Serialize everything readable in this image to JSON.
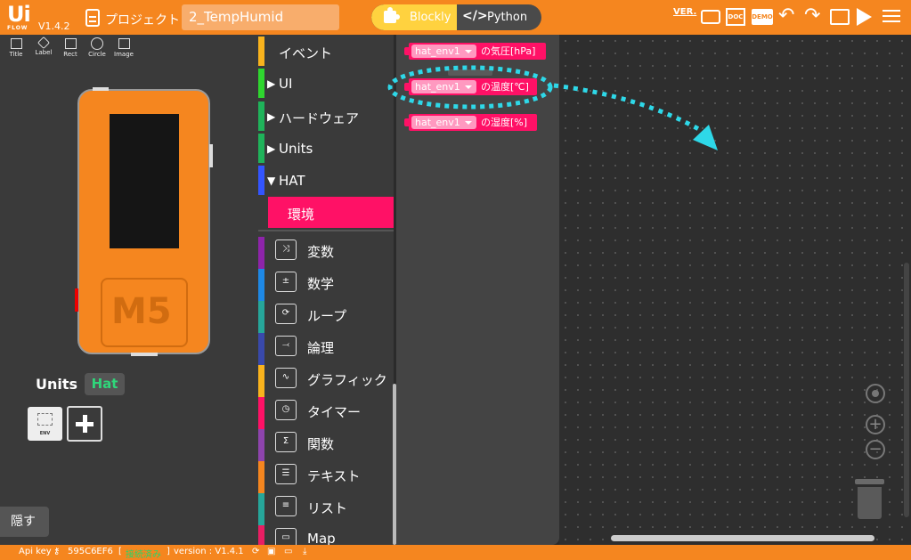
{
  "app": {
    "logo_text": "Ui",
    "logo_sub": "FLOW",
    "version": "V1.4.2",
    "project_label": "プロジェクト",
    "project_name": "2_TempHumid",
    "mode_blockly": "Blockly",
    "mode_python": "Python",
    "tool_ver": "VER.",
    "tool_doc": "DOC",
    "tool_demo": "DEMO",
    "accent_color": "#f5861f"
  },
  "shapes": [
    {
      "label": "Title",
      "icon": "title-icon"
    },
    {
      "label": "Label",
      "icon": "label-icon"
    },
    {
      "label": "Rect",
      "icon": "rect-icon"
    },
    {
      "label": "Circle",
      "icon": "circle-icon"
    },
    {
      "label": "Image",
      "icon": "image-icon"
    }
  ],
  "device": {
    "logo": "M5"
  },
  "units": {
    "label": "Units",
    "hat_badge": "Hat",
    "env_unit_label": "ENV"
  },
  "hide_button": "隠す",
  "categories": [
    {
      "label": "イベント",
      "color": "#f9b31d"
    },
    {
      "label": "UI",
      "color": "#2fd62f",
      "arrow": "▶"
    },
    {
      "label": "ハードウェア",
      "color": "#1fb35a",
      "arrow": "▶"
    },
    {
      "label": "Units",
      "color": "#1fb35a",
      "arrow": "▶"
    },
    {
      "label": "HAT",
      "color": "#3355ff",
      "arrow": "▼"
    },
    {
      "label": "環境",
      "color": "#ff1166",
      "selected": true
    }
  ],
  "categories2": [
    {
      "label": "変数",
      "color": "#8e24aa",
      "icon": "⤨"
    },
    {
      "label": "数学",
      "color": "#1e88e5",
      "icon": "±"
    },
    {
      "label": "ループ",
      "color": "#26a69a",
      "icon": "⟳"
    },
    {
      "label": "論理",
      "color": "#3949ab",
      "icon": "⤙"
    },
    {
      "label": "グラフィック",
      "color": "#f9b31d",
      "icon": "∿"
    },
    {
      "label": "タイマー",
      "color": "#ff1166",
      "icon": "◷"
    },
    {
      "label": "関数",
      "color": "#8e44ad",
      "icon": "Σ"
    },
    {
      "label": "テキスト",
      "color": "#f5861f",
      "icon": "☰"
    },
    {
      "label": "リスト",
      "color": "#26a69a",
      "icon": "≡"
    },
    {
      "label": "Map",
      "color": "#e91e63",
      "icon": "▭"
    }
  ],
  "blocks": [
    {
      "dropdown": "hat_env1",
      "text": "の気圧[hPa]"
    },
    {
      "dropdown": "hat_env1",
      "text": "の温度[℃]"
    },
    {
      "dropdown": "hat_env1",
      "text": "の湿度[%]"
    }
  ],
  "statusbar": {
    "api_key_label": "Api key :",
    "api_key": "595C6EF6",
    "connection_open": "[",
    "connection": "接続済み",
    "connection_close": "]",
    "version_label": "version : V1.4.1"
  }
}
